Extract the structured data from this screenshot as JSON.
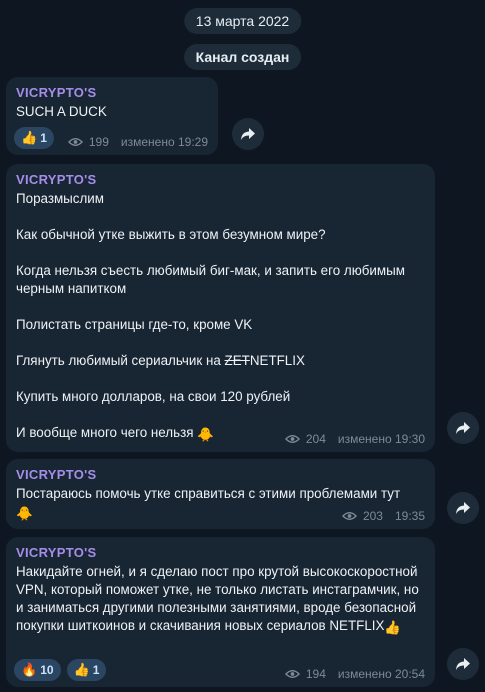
{
  "date_pill": "13 марта 2022",
  "service_pill": "Канал создан",
  "messages": [
    {
      "author": "VICRYPTO'S",
      "lines": [
        "SUCH A DUCK"
      ],
      "reactions": [
        {
          "emoji": "👍",
          "count": "1"
        }
      ],
      "views": "199",
      "time": "изменено 19:29"
    },
    {
      "author": "VICRYPTO'S",
      "lines": [
        "Поразмыслим",
        "",
        "Как обычной утке выжить в этом безумном мире?",
        "",
        "Когда нельзя съесть любимый биг-мак, и запить его любимым черным напитком",
        "",
        "Полистать страницы где-то, кроме VK",
        "",
        "Глянуть любимый сериальчик на",
        "",
        "Купить много долларов, на свои 120 рублей",
        "",
        "И вообще много чего нельзя"
      ],
      "strike_word": "ZET",
      "after_strike": "NETFLIX",
      "end_emoji": "🐥",
      "views": "204",
      "time": "изменено 19:30"
    },
    {
      "author": "VICRYPTO'S",
      "lines": [
        "Постараюсь помочь утке справиться с этими проблемами тут"
      ],
      "end_emoji": "🐥",
      "views": "203",
      "time": "19:35"
    },
    {
      "author": "VICRYPTO'S",
      "text": "Накидайте огней, и я сделаю пост про  крутой высокоскоростной VPN, который поможет утке, не только листать инстаграмчик, но и заниматься другими полезными занятиями, вроде безопасной покупки шиткоинов и скачивания новых сериалов NETFLIX",
      "end_emoji": "👍",
      "reactions": [
        {
          "emoji": "🔥",
          "count": "10"
        },
        {
          "emoji": "👍",
          "count": "1"
        }
      ],
      "views": "194",
      "time": "изменено 20:54"
    }
  ],
  "icons": {
    "views": "eye-icon",
    "share": "share-arrow-icon"
  },
  "colors": {
    "background": "#0e1621",
    "bubble": "#182533",
    "author": "#a58ee8",
    "meta": "#7d8b99",
    "reaction_bg": "#2b4662"
  }
}
